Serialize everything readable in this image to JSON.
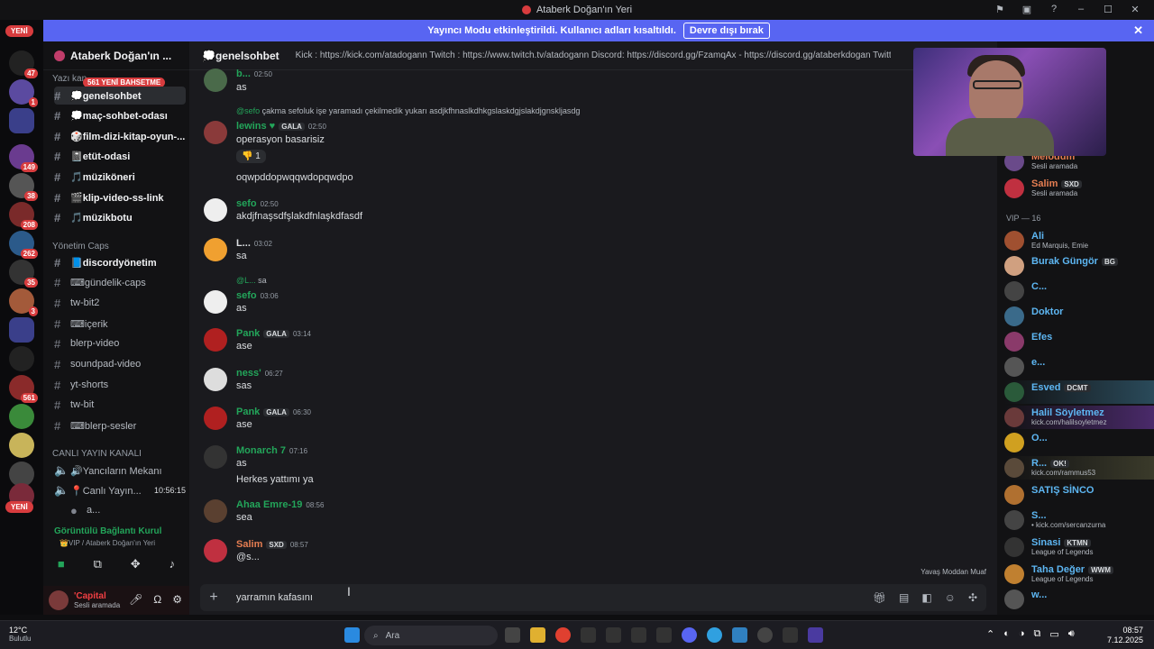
{
  "window": {
    "title": "Ataberk Doğan'ın Yeri"
  },
  "banner": {
    "text": "Yayıncı Modu etkinleştirildi. Kullanıcı adları kısaltıldı.",
    "button": "Devre dışı bırak"
  },
  "servers": {
    "yeni_top": "YENİ",
    "yeni_bottom": "YENİ",
    "badges": [
      "47",
      "1",
      "149",
      "38",
      "208",
      "262",
      "35",
      "3",
      "561"
    ]
  },
  "guild": {
    "name": "Ataberk Doğan'ın ..."
  },
  "channel_sections": {
    "text_cat": "Yazı kan...",
    "new_badge": "561 YENİ BAHSETME",
    "mgmt_cat": "Yönetim Caps",
    "live_cat": "CANLI YAYIN KANALI"
  },
  "channels": [
    {
      "label": "💭genelsohbet"
    },
    {
      "label": "💭maç-sohbet-odası"
    },
    {
      "label": "🎲film-dizi-kitap-oyun-..."
    },
    {
      "label": "📓etüt-odasi"
    },
    {
      "label": "🎵müzikönerі"
    },
    {
      "label": "🎬klip-video-ss-link"
    },
    {
      "label": "🎵müzikbotu"
    },
    {
      "label": "📘discordyönetim"
    },
    {
      "label": "⌨gündelik-caps"
    },
    {
      "label": "tw-bit2"
    },
    {
      "label": "⌨içerik"
    },
    {
      "label": "blerp-video"
    },
    {
      "label": "soundpad-video"
    },
    {
      "label": "yt-shorts"
    },
    {
      "label": "tw-bit"
    },
    {
      "label": "⌨blerp-sesler"
    },
    {
      "label": "🔊Yancıların Mekanı"
    },
    {
      "label": "📍Canlı Yayın...",
      "time": "10:56:15"
    },
    {
      "label": "a..."
    }
  ],
  "voice": {
    "title": "Görüntülü Bağlantı Kurul",
    "sub": "👑VIP / Ataberk Doğan'ın Yeri"
  },
  "user": {
    "name": "'Capital",
    "status": "Sesli aramada"
  },
  "header": {
    "channel": "💭genelsohbet",
    "topic": "Kick : https://kick.com/atadogann Twitch : https://www.twitch.tv/atadogann Discord: https://discord.gg/FzamqAx - https://discord.gg/ataberkdogan Twitter : https..."
  },
  "messages": [
    {
      "user": "b...",
      "time": "02:50",
      "text": "as",
      "color": "#23a55a"
    },
    {
      "reply_user": "@sefo",
      "reply": "çakma sefoluk işe yaramadı çekilmedik yukarı asdjkfhnaslkdhkgslaskdgjslakdjgnskljasdg",
      "user": "lewins ♥",
      "tag": "GALA",
      "time": "02:50",
      "text": "operasyon basarisiz",
      "reaction": "1",
      "color": "#23a55a"
    },
    {
      "text": "oqwpddopwqqwdopqwdpo"
    },
    {
      "user": "sefo",
      "time": "02:50",
      "text": "akdjfnaşsdfşlakdfnlaşkdfasdf",
      "color": "#23a55a"
    },
    {
      "user": "L...",
      "time": "03:02",
      "text": "sa",
      "color": "#dbdee1"
    },
    {
      "reply_user": "@L...",
      "reply": "sa",
      "user": "sefo",
      "time": "03:06",
      "text": "as",
      "color": "#23a55a"
    },
    {
      "user": "Pank",
      "tag": "GALA",
      "time": "03:14",
      "text": "ase",
      "color": "#23a55a"
    },
    {
      "user": "ness'",
      "time": "06:27",
      "text": "sas",
      "color": "#23a55a"
    },
    {
      "user": "Pank",
      "tag": "GALA",
      "time": "06:30",
      "text": "ase",
      "color": "#23a55a"
    },
    {
      "user": "Monarch 7",
      "time": "07:16",
      "text": "as",
      "color": "#23a55a"
    },
    {
      "text": "Herkes yattımı ya"
    },
    {
      "user": "Ahaa Emre-19",
      "time": "08:56",
      "text": "sea",
      "color": "#23a55a"
    },
    {
      "user": "Salim",
      "tag": "SXD",
      "time": "08:57",
      "text": "@s...",
      "color": "#e67e52"
    }
  ],
  "slowmode": "Yavaş Moddan Muaf",
  "input": {
    "value": "yarramın kafasını"
  },
  "members": {
    "top": [
      {
        "name": "Melodum",
        "sub": "Sesli aramada"
      },
      {
        "name": "Salim",
        "tag": "SXD",
        "sub": "Sesli aramada"
      }
    ],
    "vip_header": "VIP — 16",
    "vip": [
      {
        "name": "Ali",
        "sub": "Ed Marquis, Emie"
      },
      {
        "name": "Burak Güngör",
        "tag": "BG"
      },
      {
        "name": "C..."
      },
      {
        "name": "Doktor"
      },
      {
        "name": "Efes"
      },
      {
        "name": "e..."
      },
      {
        "name": "Esved",
        "tag": "DCMT"
      },
      {
        "name": "Halil Söyletmez",
        "sub": "kick.com/halilsoyletmez"
      },
      {
        "name": "O..."
      },
      {
        "name": "R...",
        "tag": "OK!",
        "sub": "kick.com/rammus53"
      },
      {
        "name": "SATIŞ SİNCO"
      },
      {
        "name": "S...",
        "sub": "• kick.com/sercanzurna"
      },
      {
        "name": "Sinasi",
        "tag": "KTMN",
        "sub": "League of Legends"
      },
      {
        "name": "Taha Değer",
        "tag": "WWM",
        "sub": "League of Legends"
      },
      {
        "name": "w..."
      }
    ]
  },
  "taskbar": {
    "temp": "12°C",
    "weather": "Bulutlu",
    "search": "Ara",
    "time": "08:57",
    "date": "7.12.2025"
  }
}
